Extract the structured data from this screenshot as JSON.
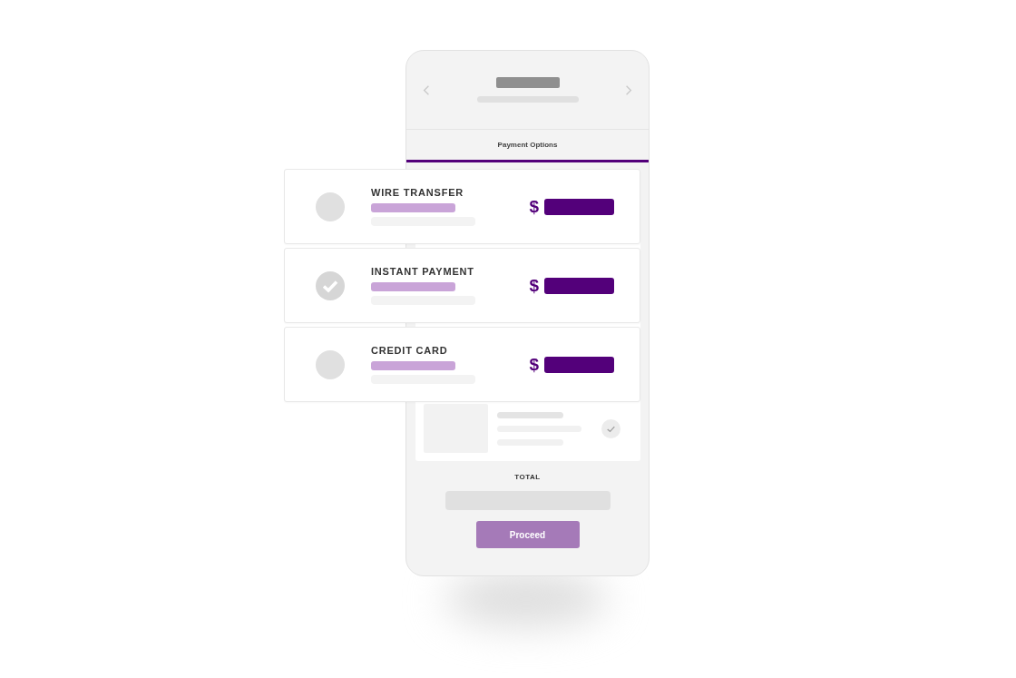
{
  "phone": {
    "tab": {
      "label": "Payment Options",
      "selected": true
    }
  },
  "payment_options": [
    {
      "title": "WIRE TRANSFER",
      "currency": "$",
      "selected": false
    },
    {
      "title": "INSTANT PAYMENT",
      "currency": "$",
      "selected": true
    },
    {
      "title": "CREDIT CARD",
      "currency": "$",
      "selected": false
    }
  ],
  "total": {
    "label": "TOTAL"
  },
  "proceed_button": "Proceed"
}
